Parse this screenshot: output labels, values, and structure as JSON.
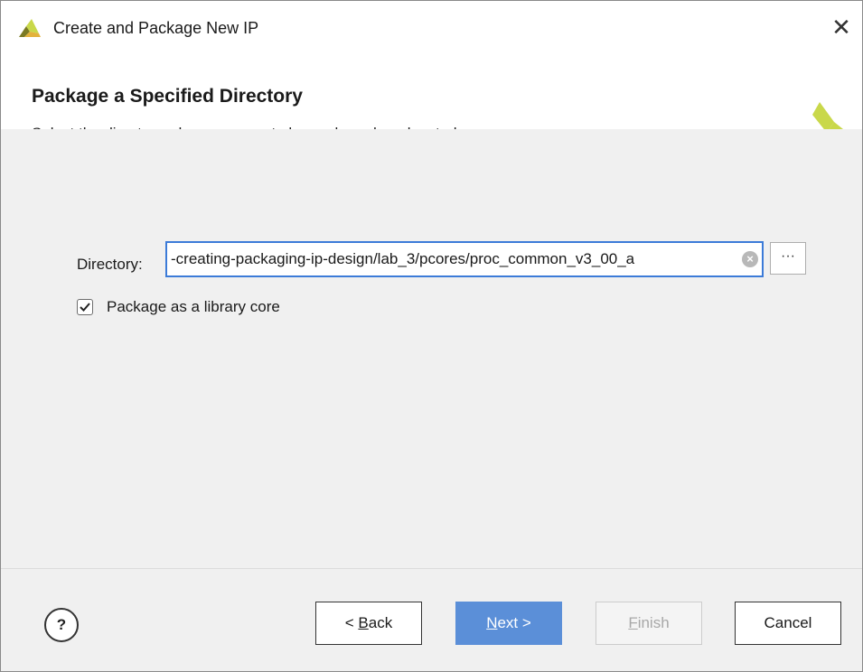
{
  "window": {
    "title": "Create and Package New IP",
    "close_glyph": "✕"
  },
  "header": {
    "heading": "Package a Specified Directory",
    "subheading": "Select the directory where sources to be packaged are located."
  },
  "form": {
    "directory_label": "Directory:",
    "directory_value": "-creating-packaging-ip-design/lab_3/pcores/proc_common_v3_00_a",
    "clear_glyph": "×",
    "browse_label": "···",
    "package_library_checked": true,
    "package_library_label": "Package as a library core"
  },
  "footer": {
    "help_label": "?",
    "back_prefix": "< ",
    "back_mnemonic": "B",
    "back_rest": "ack",
    "next_mnemonic": "N",
    "next_rest": "ext >",
    "finish_mnemonic": "F",
    "finish_rest": "inish",
    "cancel_label": "Cancel"
  },
  "colors": {
    "accent": "#3c7bd8",
    "next_button_bg": "#5b8fd8",
    "logo_dark": "#6b6b1e",
    "logo_light": "#c9d84a"
  },
  "icons": {
    "app": "xilinx-logo-icon",
    "brand": "xilinx-logo-icon",
    "close": "close-icon",
    "clear": "clear-input-icon",
    "checkbox": "checkmark-icon"
  }
}
